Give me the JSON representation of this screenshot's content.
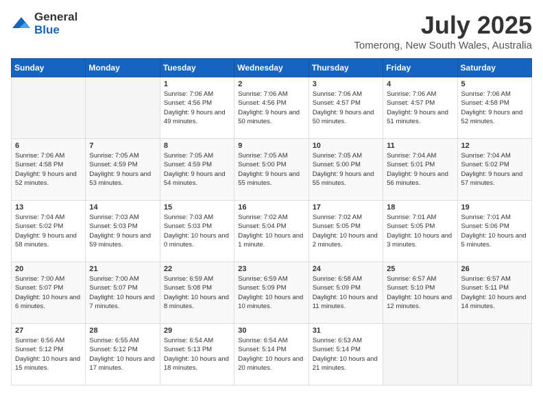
{
  "header": {
    "logo": {
      "general": "General",
      "blue": "Blue"
    },
    "title": "July 2025",
    "location": "Tomerong, New South Wales, Australia"
  },
  "calendar": {
    "days_of_week": [
      "Sunday",
      "Monday",
      "Tuesday",
      "Wednesday",
      "Thursday",
      "Friday",
      "Saturday"
    ],
    "weeks": [
      [
        {
          "day": "",
          "info": ""
        },
        {
          "day": "",
          "info": ""
        },
        {
          "day": "1",
          "info": "Sunrise: 7:06 AM\nSunset: 4:56 PM\nDaylight: 9 hours and 49 minutes."
        },
        {
          "day": "2",
          "info": "Sunrise: 7:06 AM\nSunset: 4:56 PM\nDaylight: 9 hours and 50 minutes."
        },
        {
          "day": "3",
          "info": "Sunrise: 7:06 AM\nSunset: 4:57 PM\nDaylight: 9 hours and 50 minutes."
        },
        {
          "day": "4",
          "info": "Sunrise: 7:06 AM\nSunset: 4:57 PM\nDaylight: 9 hours and 51 minutes."
        },
        {
          "day": "5",
          "info": "Sunrise: 7:06 AM\nSunset: 4:58 PM\nDaylight: 9 hours and 52 minutes."
        }
      ],
      [
        {
          "day": "6",
          "info": "Sunrise: 7:06 AM\nSunset: 4:58 PM\nDaylight: 9 hours and 52 minutes."
        },
        {
          "day": "7",
          "info": "Sunrise: 7:05 AM\nSunset: 4:59 PM\nDaylight: 9 hours and 53 minutes."
        },
        {
          "day": "8",
          "info": "Sunrise: 7:05 AM\nSunset: 4:59 PM\nDaylight: 9 hours and 54 minutes."
        },
        {
          "day": "9",
          "info": "Sunrise: 7:05 AM\nSunset: 5:00 PM\nDaylight: 9 hours and 55 minutes."
        },
        {
          "day": "10",
          "info": "Sunrise: 7:05 AM\nSunset: 5:00 PM\nDaylight: 9 hours and 55 minutes."
        },
        {
          "day": "11",
          "info": "Sunrise: 7:04 AM\nSunset: 5:01 PM\nDaylight: 9 hours and 56 minutes."
        },
        {
          "day": "12",
          "info": "Sunrise: 7:04 AM\nSunset: 5:02 PM\nDaylight: 9 hours and 57 minutes."
        }
      ],
      [
        {
          "day": "13",
          "info": "Sunrise: 7:04 AM\nSunset: 5:02 PM\nDaylight: 9 hours and 58 minutes."
        },
        {
          "day": "14",
          "info": "Sunrise: 7:03 AM\nSunset: 5:03 PM\nDaylight: 9 hours and 59 minutes."
        },
        {
          "day": "15",
          "info": "Sunrise: 7:03 AM\nSunset: 5:03 PM\nDaylight: 10 hours and 0 minutes."
        },
        {
          "day": "16",
          "info": "Sunrise: 7:02 AM\nSunset: 5:04 PM\nDaylight: 10 hours and 1 minute."
        },
        {
          "day": "17",
          "info": "Sunrise: 7:02 AM\nSunset: 5:05 PM\nDaylight: 10 hours and 2 minutes."
        },
        {
          "day": "18",
          "info": "Sunrise: 7:01 AM\nSunset: 5:05 PM\nDaylight: 10 hours and 3 minutes."
        },
        {
          "day": "19",
          "info": "Sunrise: 7:01 AM\nSunset: 5:06 PM\nDaylight: 10 hours and 5 minutes."
        }
      ],
      [
        {
          "day": "20",
          "info": "Sunrise: 7:00 AM\nSunset: 5:07 PM\nDaylight: 10 hours and 6 minutes."
        },
        {
          "day": "21",
          "info": "Sunrise: 7:00 AM\nSunset: 5:07 PM\nDaylight: 10 hours and 7 minutes."
        },
        {
          "day": "22",
          "info": "Sunrise: 6:59 AM\nSunset: 5:08 PM\nDaylight: 10 hours and 8 minutes."
        },
        {
          "day": "23",
          "info": "Sunrise: 6:59 AM\nSunset: 5:09 PM\nDaylight: 10 hours and 10 minutes."
        },
        {
          "day": "24",
          "info": "Sunrise: 6:58 AM\nSunset: 5:09 PM\nDaylight: 10 hours and 11 minutes."
        },
        {
          "day": "25",
          "info": "Sunrise: 6:57 AM\nSunset: 5:10 PM\nDaylight: 10 hours and 12 minutes."
        },
        {
          "day": "26",
          "info": "Sunrise: 6:57 AM\nSunset: 5:11 PM\nDaylight: 10 hours and 14 minutes."
        }
      ],
      [
        {
          "day": "27",
          "info": "Sunrise: 6:56 AM\nSunset: 5:12 PM\nDaylight: 10 hours and 15 minutes."
        },
        {
          "day": "28",
          "info": "Sunrise: 6:55 AM\nSunset: 5:12 PM\nDaylight: 10 hours and 17 minutes."
        },
        {
          "day": "29",
          "info": "Sunrise: 6:54 AM\nSunset: 5:13 PM\nDaylight: 10 hours and 18 minutes."
        },
        {
          "day": "30",
          "info": "Sunrise: 6:54 AM\nSunset: 5:14 PM\nDaylight: 10 hours and 20 minutes."
        },
        {
          "day": "31",
          "info": "Sunrise: 6:53 AM\nSunset: 5:14 PM\nDaylight: 10 hours and 21 minutes."
        },
        {
          "day": "",
          "info": ""
        },
        {
          "day": "",
          "info": ""
        }
      ]
    ]
  }
}
